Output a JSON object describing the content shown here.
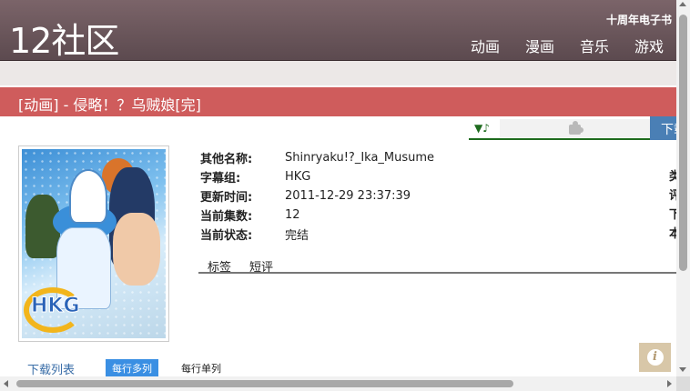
{
  "header": {
    "logo": "12社区",
    "top_link": "十周年电子书",
    "nav": [
      "动画",
      "漫画",
      "音乐",
      "游戏"
    ]
  },
  "title_bar": {
    "text": "[动画] - 侵略！？乌贼娘[完]"
  },
  "player": {
    "icon_text": "▼♪",
    "plugin_icon": "puzzle-icon",
    "download_label": "下载"
  },
  "cover": {
    "logo_text": "HKG"
  },
  "info": {
    "rows": [
      {
        "label": "其他名称:",
        "value": "Shinryaku!?_Ika_Musume"
      },
      {
        "label": "字幕组:",
        "value": "HKG"
      },
      {
        "label": "更新时间:",
        "value": "2011-12-29 23:37:39"
      },
      {
        "label": "当前集数:",
        "value": "12"
      },
      {
        "label": "当前状态:",
        "value": "完结"
      }
    ],
    "right_cut": [
      "类",
      "评",
      "下",
      "本"
    ]
  },
  "tabs": [
    "标签",
    "短评"
  ],
  "download_list": {
    "title": "下载列表",
    "mode_active": "每行多列",
    "mode_inactive": "每行单列"
  },
  "colors": {
    "header_bg": "#5c4a4f",
    "title_bar_bg": "#cf5c5c",
    "accent_blue": "#3a8fe3",
    "player_green": "#1e6b1e"
  }
}
